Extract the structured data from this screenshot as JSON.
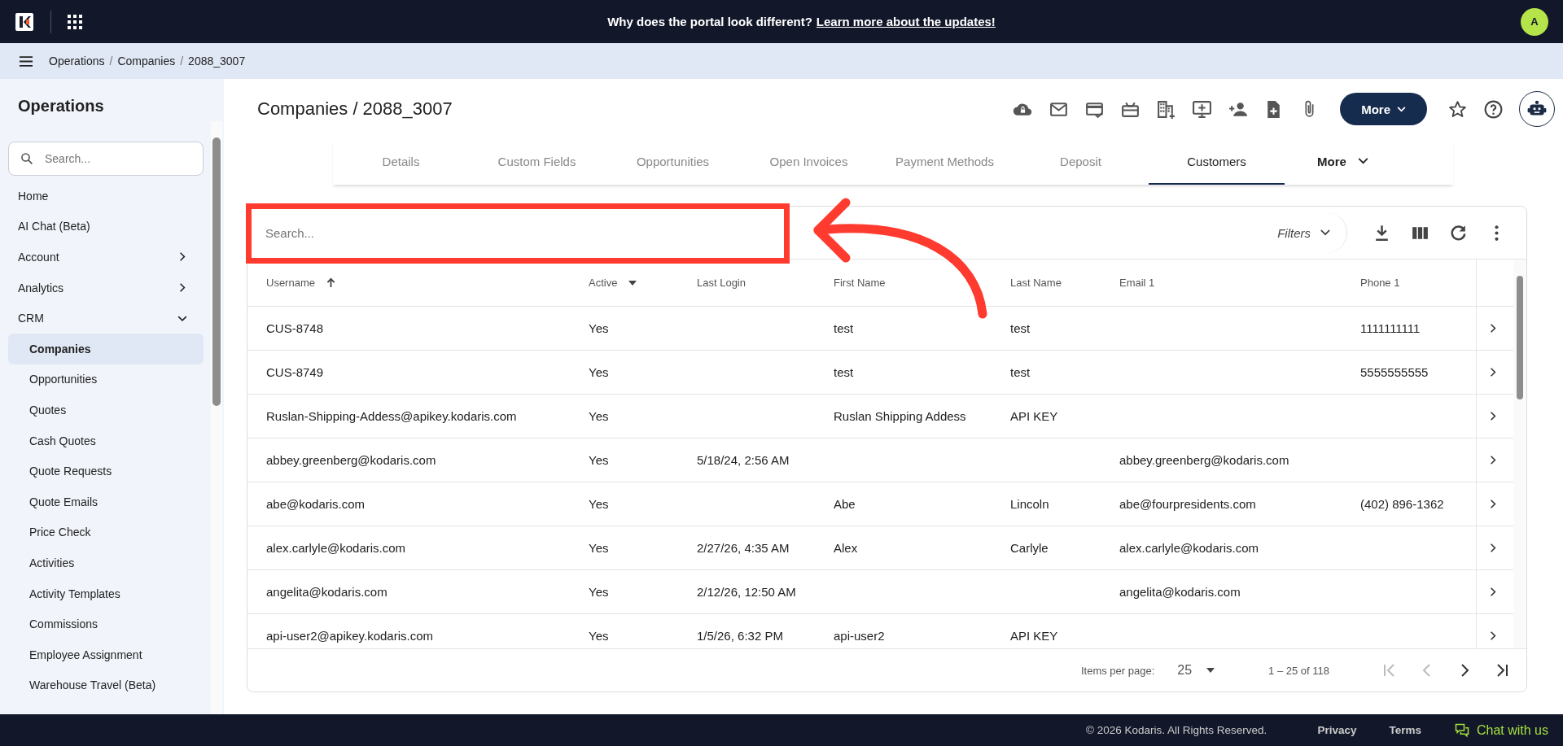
{
  "top_bar": {
    "announcement": "Why does the portal look different?",
    "link": "Learn more about the updates!",
    "avatar": "A"
  },
  "breadcrumbs": {
    "separator": "/",
    "items": [
      "Operations",
      "Companies",
      "2088_3007"
    ]
  },
  "sidebar": {
    "title": "Operations",
    "search_placeholder": "Search...",
    "items": [
      {
        "label": "Home",
        "kind": "link",
        "selected": false
      },
      {
        "label": "AI Chat (Beta)",
        "kind": "link",
        "selected": false
      },
      {
        "label": "Account",
        "kind": "group",
        "expanded": false,
        "selected": false
      },
      {
        "label": "Analytics",
        "kind": "group",
        "expanded": false,
        "selected": false
      },
      {
        "label": "CRM",
        "kind": "group",
        "expanded": true,
        "selected": false,
        "children": [
          {
            "label": "Companies",
            "selected": true
          },
          {
            "label": "Opportunities",
            "selected": false
          },
          {
            "label": "Quotes",
            "selected": false
          },
          {
            "label": "Cash Quotes",
            "selected": false
          },
          {
            "label": "Quote Requests",
            "selected": false
          },
          {
            "label": "Quote Emails",
            "selected": false
          },
          {
            "label": "Price Check",
            "selected": false
          },
          {
            "label": "Activities",
            "selected": false
          },
          {
            "label": "Activity Templates",
            "selected": false
          },
          {
            "label": "Commissions",
            "selected": false
          },
          {
            "label": "Employee Assignment",
            "selected": false
          },
          {
            "label": "Warehouse Travel (Beta)",
            "selected": false
          }
        ]
      }
    ]
  },
  "page": {
    "title": "Companies / 2088_3007",
    "more_button": "More",
    "tabs": [
      {
        "label": "Details",
        "kind": "tab",
        "selected": false
      },
      {
        "label": "Custom Fields",
        "kind": "tab",
        "selected": false
      },
      {
        "label": "Opportunities",
        "kind": "tab",
        "selected": false
      },
      {
        "label": "Open Invoices",
        "kind": "tab",
        "selected": false
      },
      {
        "label": "Payment Methods",
        "kind": "tab",
        "selected": false
      },
      {
        "label": "Deposit",
        "kind": "tab",
        "selected": false
      },
      {
        "label": "Customers",
        "kind": "tab",
        "selected": true
      },
      {
        "label": "More",
        "kind": "menu",
        "selected": false
      }
    ]
  },
  "table": {
    "search_placeholder": "Search...",
    "filters": "Filters",
    "columns": [
      {
        "label": "Username",
        "kind": "sorted"
      },
      {
        "label": "Active",
        "kind": "dropdown"
      },
      {
        "label": "Last Login",
        "kind": "plain"
      },
      {
        "label": "First Name",
        "kind": "plain"
      },
      {
        "label": "Last Name",
        "kind": "plain"
      },
      {
        "label": "Email 1",
        "kind": "plain"
      },
      {
        "label": "Phone 1",
        "kind": "plain"
      }
    ],
    "rows": [
      [
        "CUS-8748",
        "Yes",
        "",
        "test",
        "test",
        "",
        "1111111111"
      ],
      [
        "CUS-8749",
        "Yes",
        "",
        "test",
        "test",
        "",
        "5555555555"
      ],
      [
        "Ruslan-Shipping-Addess@apikey.kodaris.com",
        "Yes",
        "",
        "Ruslan Shipping Addess",
        "API KEY",
        "",
        ""
      ],
      [
        "abbey.greenberg@kodaris.com",
        "Yes",
        "5/18/24, 2:56 AM",
        "",
        "",
        "abbey.greenberg@kodaris.com",
        ""
      ],
      [
        "abe@kodaris.com",
        "Yes",
        "",
        "Abe",
        "Lincoln",
        "abe@fourpresidents.com",
        "(402) 896-1362"
      ],
      [
        "alex.carlyle@kodaris.com",
        "Yes",
        "2/27/26, 4:35 AM",
        "Alex",
        "Carlyle",
        "alex.carlyle@kodaris.com",
        ""
      ],
      [
        "angelita@kodaris.com",
        "Yes",
        "2/12/26, 12:50 AM",
        "",
        "",
        "angelita@kodaris.com",
        ""
      ],
      [
        "api-user2@apikey.kodaris.com",
        "Yes",
        "1/5/26, 6:32 PM",
        "api-user2",
        "API KEY",
        "",
        ""
      ]
    ],
    "pagination": {
      "items_label": "Items per page:",
      "page_size": "25",
      "range": "1 – 25 of 118"
    }
  },
  "footer": {
    "copyright": "© 2026 Kodaris. All Rights Reserved.",
    "links": [
      "Privacy",
      "Terms"
    ],
    "chat": "Chat with us"
  }
}
